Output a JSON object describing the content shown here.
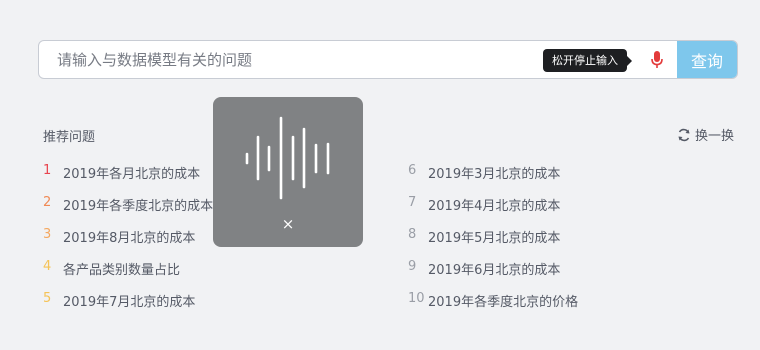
{
  "search": {
    "placeholder": "请输入与数据模型有关的问题",
    "tooltip": "松开停止输入",
    "button_label": "查询"
  },
  "recommend": {
    "title": "推荐问题",
    "refresh_label": "换一换",
    "questions": [
      {
        "num": "1",
        "text": "2019年各月北京的成本",
        "color": "#e8454f"
      },
      {
        "num": "2",
        "text": "2019年各季度北京的成本",
        "color": "#f08a55"
      },
      {
        "num": "3",
        "text": "2019年8月北京的成本",
        "color": "#f4a860"
      },
      {
        "num": "4",
        "text": "各产品类别数量占比",
        "color": "#f5c356"
      },
      {
        "num": "5",
        "text": "2019年7月北京的成本",
        "color": "#f5c356"
      },
      {
        "num": "6",
        "text": "2019年3月北京的成本",
        "color": "#9a9ea6"
      },
      {
        "num": "7",
        "text": "2019年4月北京的成本",
        "color": "#9a9ea6"
      },
      {
        "num": "8",
        "text": "2019年5月北京的成本",
        "color": "#9a9ea6"
      },
      {
        "num": "9",
        "text": "2019年6月北京的成本",
        "color": "#9a9ea6"
      },
      {
        "num": "10",
        "text": "2019年各季度北京的价格",
        "color": "#9a9ea6"
      }
    ]
  },
  "voice": {
    "close_symbol": "×"
  },
  "colors": {
    "accent": "#7ec7ec",
    "mic": "#e33b3b"
  },
  "icons": [
    "microphone-icon",
    "refresh-icon",
    "sound-wave-icon",
    "close-icon"
  ]
}
